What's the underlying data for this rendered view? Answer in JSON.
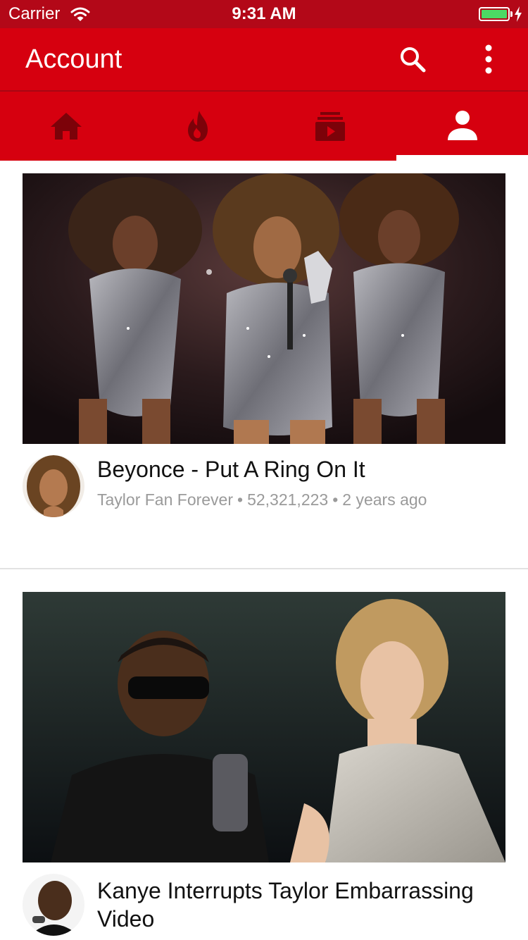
{
  "status_bar": {
    "carrier": "Carrier",
    "time": "9:31 AM",
    "battery_color": "#4cd964"
  },
  "app_bar": {
    "title": "Account",
    "background": "#d6000f",
    "actions": [
      "search-icon",
      "more-vertical-icon"
    ]
  },
  "tabs": [
    {
      "icon": "home-icon",
      "selected": false
    },
    {
      "icon": "fire-icon",
      "selected": false
    },
    {
      "icon": "subscriptions-icon",
      "selected": false
    },
    {
      "icon": "person-icon",
      "selected": true
    }
  ],
  "videos": [
    {
      "title": "Beyonce - Put A Ring On It",
      "channel": "Taylor Fan Forever",
      "views": "52,321,223",
      "age": "2 years ago",
      "separator": "•"
    },
    {
      "title": "Kanye Interrupts Taylor Embarrassing Video"
    }
  ]
}
